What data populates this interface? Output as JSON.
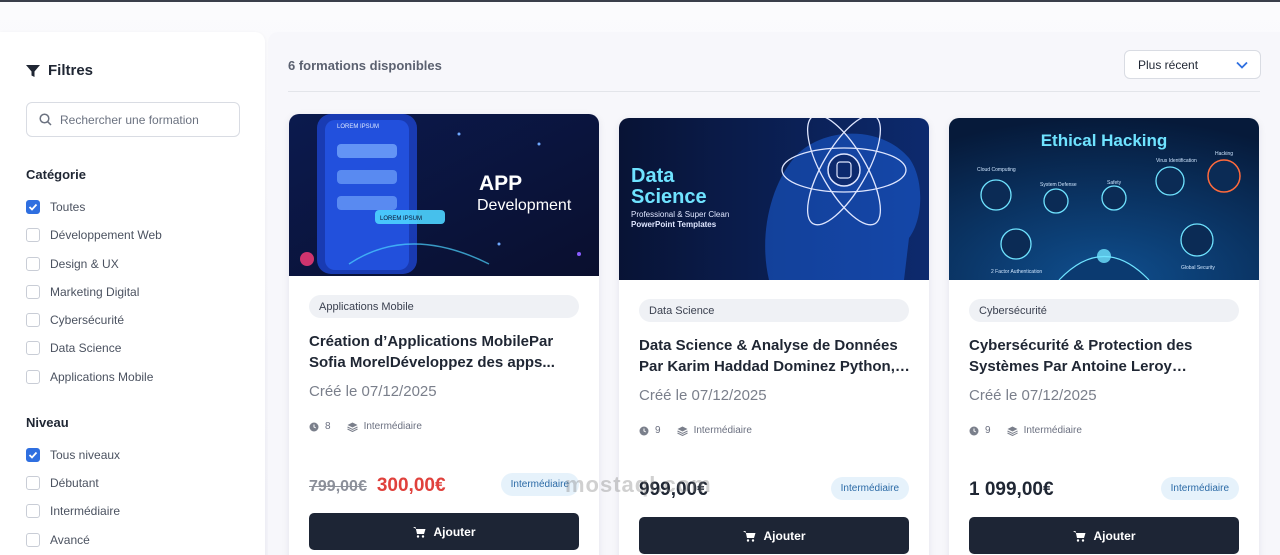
{
  "sidebar": {
    "title": "Filtres",
    "search_placeholder": "Rechercher une formation",
    "category": {
      "title": "Catégorie",
      "items": [
        {
          "label": "Toutes",
          "checked": true
        },
        {
          "label": "Développement Web",
          "checked": false
        },
        {
          "label": "Design & UX",
          "checked": false
        },
        {
          "label": "Marketing Digital",
          "checked": false
        },
        {
          "label": "Cybersécurité",
          "checked": false
        },
        {
          "label": "Data Science",
          "checked": false
        },
        {
          "label": "Applications Mobile",
          "checked": false
        }
      ]
    },
    "level": {
      "title": "Niveau",
      "items": [
        {
          "label": "Tous niveaux",
          "checked": true
        },
        {
          "label": "Débutant",
          "checked": false
        },
        {
          "label": "Intermédiaire",
          "checked": false
        },
        {
          "label": "Avancé",
          "checked": false
        }
      ]
    }
  },
  "main": {
    "count_text": "6 formations disponibles",
    "sort": {
      "selected": "Plus récent"
    },
    "cards": [
      {
        "banner": {
          "line1": "APP",
          "line2": "Development",
          "screen_label": "LOREM IPSUM",
          "button_label": "LOREM IPSUM"
        },
        "category": "Applications Mobile",
        "title": "Création d’Applications MobilePar Sofia MorelDéveloppez des apps...",
        "date": "Créé le 07/12/2025",
        "modules": "8",
        "level": "Intermédiaire",
        "old_price": "799,00€",
        "price": "300,00€",
        "badge": "Intermédiaire",
        "button": "Ajouter"
      },
      {
        "banner": {
          "line1": "Data",
          "line2": "Science",
          "line3": "Professional & Super Clean",
          "line4": "PowerPoint Templates"
        },
        "category": "Data Science",
        "title": "Data Science & Analyse de Données Par Karim Haddad Dominez Python, Pand...",
        "date": "Créé le 07/12/2025",
        "modules": "9",
        "level": "Intermédiaire",
        "price": "999,00€",
        "badge": "Intermédiaire",
        "button": "Ajouter"
      },
      {
        "banner": {
          "title": "Ethical Hacking",
          "labels": [
            "Cloud Computing",
            "System Defense",
            "Safety",
            "Virus Identification",
            "Hacking",
            "2 Factor Authentication",
            "Global Security"
          ]
        },
        "category": "Cybersécurité",
        "title": "Cybersécurité & Protection des Systèmes Par Antoine Leroy Compren...",
        "date": "Créé le 07/12/2025",
        "modules": "9",
        "level": "Intermédiaire",
        "price": "1 099,00€",
        "badge": "Intermédiaire",
        "button": "Ajouter"
      }
    ]
  },
  "watermark": "mostaql.com",
  "colors": {
    "accent": "#2f6fe0",
    "button": "#1d2535",
    "discount": "#e0413c",
    "badge_bg": "#e6f2fb"
  }
}
